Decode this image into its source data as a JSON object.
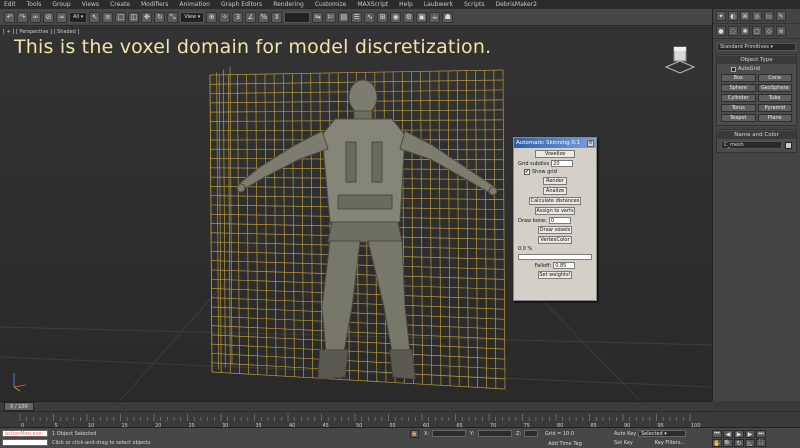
{
  "menu": [
    "Edit",
    "Tools",
    "Group",
    "Views",
    "Create",
    "Modifiers",
    "Animation",
    "Graph Editors",
    "Rendering",
    "Customize",
    "MAXScript",
    "Help",
    "Laubwerk",
    "Scripts",
    "DebrisMaker2"
  ],
  "toolbar": {
    "selection_filter": "All",
    "view_dropdown": "View",
    "icons": [
      "undo-icon",
      "redo-icon",
      "link-icon",
      "unlink-icon",
      "bind-icon",
      "select-icon",
      "select-name-icon",
      "rect-select-icon",
      "window-crossing-icon",
      "move-icon",
      "rotate-icon",
      "scale-icon",
      "snap-icon",
      "angle-snap-icon",
      "percent-snap-icon",
      "spinner-snap-icon",
      "named-set-icon",
      "mirror-icon",
      "align-icon",
      "layer-icon",
      "curve-editor-icon",
      "schematic-icon",
      "material-editor-icon",
      "render-setup-icon",
      "render-frame-icon",
      "render-icon"
    ]
  },
  "viewport": {
    "label": "[ + ] [ Perspective ] [ Shaded ]",
    "caption": "This is the voxel domain for model discretization.",
    "grid_color": "#b89a3c"
  },
  "command_panel": {
    "tabs": [
      "create-tab",
      "modify-tab",
      "hierarchy-tab",
      "motion-tab",
      "display-tab",
      "utilities-tab"
    ],
    "icon_row": [
      "geometry-icon",
      "shapes-icon",
      "lights-icon",
      "cameras-icon",
      "helpers-icon",
      "spacewarps-icon",
      "systems-icon"
    ],
    "category": "Standard Primitives",
    "object_type_title": "Object Type",
    "autogrid_label": "AutoGrid",
    "buttons": [
      "Box",
      "Cone",
      "Sphere",
      "GeoSphere",
      "Cylinder",
      "Tube",
      "Torus",
      "Pyramid",
      "Teapot",
      "Plane"
    ],
    "name_color_title": "Name and Color",
    "object_name": "C_mesh"
  },
  "dialog": {
    "title": "Automatic Skinning 0.1",
    "top_button": "Voxelize",
    "grid_subdiv_label": "Grid subdivs",
    "grid_subdiv_value": "20",
    "show_grid_label": "Show grid",
    "render_label": "Render",
    "analize_label": "Analize",
    "calc_distances_label": "Calculate distances",
    "assign_verts_label": "Assign to verts",
    "draw_bone_label": "Draw bone:",
    "draw_bone_value": "0",
    "draw_voxels_label": "Draw voxels",
    "vertex_color_label": "VertexColor",
    "progress_label": "0.0 %",
    "falloff_label": "Falloff:",
    "falloff_value": "0.85",
    "set_weights_label": "Set weights!"
  },
  "timeline": {
    "frame_counter": "0 / 100",
    "ticks": [
      "0",
      "5",
      "10",
      "15",
      "20",
      "25",
      "30",
      "35",
      "40",
      "45",
      "50",
      "55",
      "60",
      "65",
      "70",
      "75",
      "80",
      "85",
      "90",
      "95",
      "100"
    ]
  },
  "status": {
    "listener_text": "actionMan.exe",
    "selection_text": "1 Object Selected",
    "prompt_text": "Click or click-and-drag to select objects",
    "x_label": "X:",
    "y_label": "Y:",
    "z_label": "Z:",
    "grid_text": "Grid = 10.0",
    "add_time_tag": "Add Time Tag",
    "auto_key": "Auto Key",
    "selected_dropdown": "Selected",
    "set_key": "Set Key",
    "key_filters": "Key Filters..."
  },
  "colors": {
    "accent_yellow": "#f2e4a6",
    "dialog_title": "#2f5fa8",
    "viewport_bg": "#303030"
  }
}
